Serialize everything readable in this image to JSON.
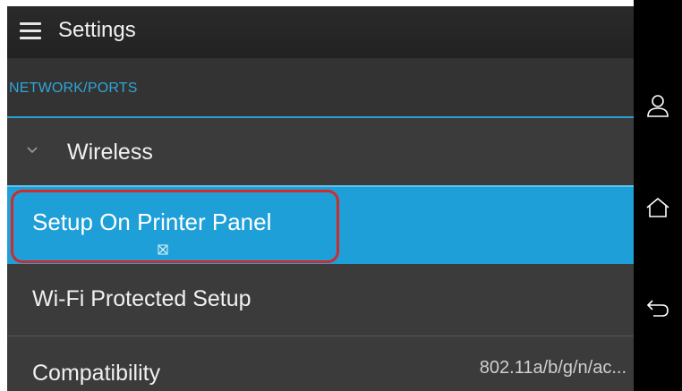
{
  "header": {
    "title": "Settings",
    "menu_icon": "hamburger-menu-icon"
  },
  "section": {
    "label": "NETWORK/PORTS"
  },
  "items": [
    {
      "label": "Wireless",
      "icon": "chevron-down-icon",
      "expanded": true
    },
    {
      "label": "Setup On Printer Panel",
      "selected": true
    },
    {
      "label": "Wi-Fi Protected Setup"
    },
    {
      "label": "Compatibility",
      "value": "802.11a/b/g/n/ac..."
    }
  ],
  "nav": {
    "user_icon": "user-icon",
    "home_icon": "home-icon",
    "back_icon": "back-icon"
  },
  "colors": {
    "accent": "#1e9fd8",
    "section_text": "#2fa6d9",
    "highlight_ring": "#d02b2b",
    "background": "#3b3b3b"
  }
}
